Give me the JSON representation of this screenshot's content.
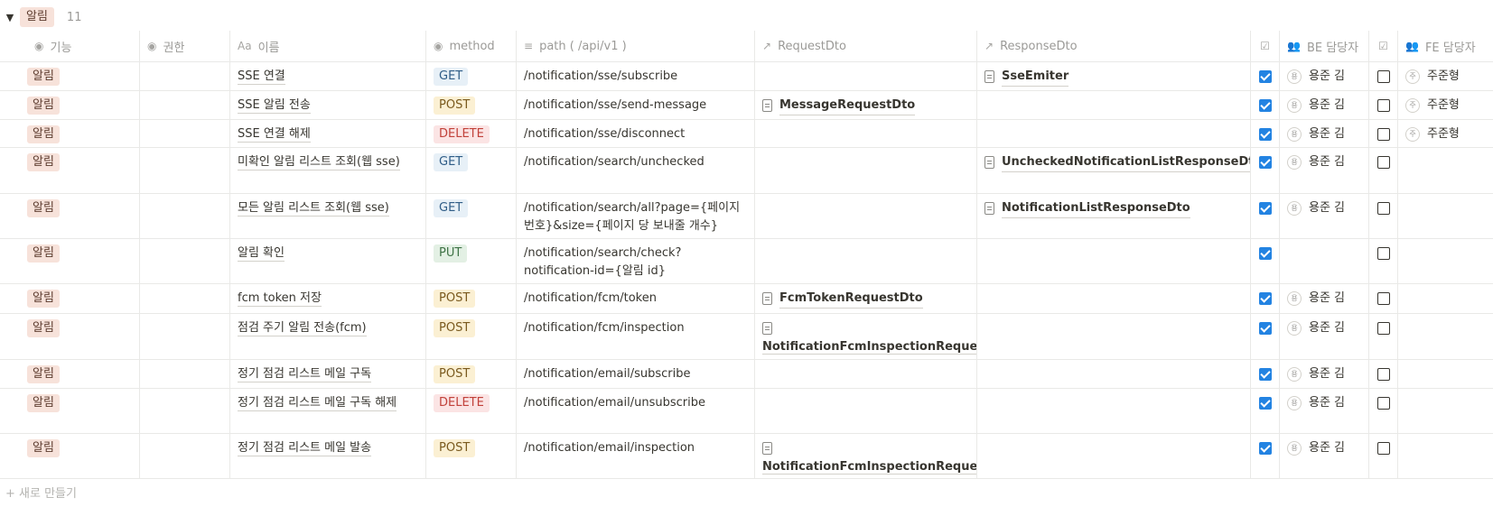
{
  "group": {
    "label": "알림",
    "count": "11",
    "toggle_icon": "▼"
  },
  "headers": {
    "feature": {
      "icon": "◉",
      "label": "기능"
    },
    "auth": {
      "icon": "◉",
      "label": "권한"
    },
    "name": {
      "icon": "Aa",
      "label": "이름"
    },
    "method": {
      "icon": "◉",
      "label": "method"
    },
    "path": {
      "icon": "≡",
      "label": "path ( /api/v1 )"
    },
    "req": {
      "icon": "↗",
      "label": "RequestDto"
    },
    "res": {
      "icon": "↗",
      "label": "ResponseDto"
    },
    "becheck": {
      "icon": "☑",
      "label": ""
    },
    "be": {
      "icon": "👥",
      "label": "BE 담당자"
    },
    "fecheck": {
      "icon": "☑",
      "label": ""
    },
    "fe": {
      "icon": "👥",
      "label": "FE 담당자"
    }
  },
  "method_colors": {
    "GET": {
      "bg": "#e7f0f7",
      "fg": "#2f5d87"
    },
    "POST": {
      "bg": "#fbf0d3",
      "fg": "#7a5a1e"
    },
    "DELETE": {
      "bg": "#fbe4e4",
      "fg": "#c1413a"
    },
    "PUT": {
      "bg": "#e3f0e4",
      "fg": "#3f7346"
    }
  },
  "rows": [
    {
      "feature": "알림",
      "name": "SSE 연결",
      "method": "GET",
      "path": "/notification/sse/subscribe",
      "req": "",
      "req_block": false,
      "res": "SseEmiter",
      "be_check": true,
      "be": "용준 김",
      "be_initial": "용",
      "fe_check": false,
      "fe": "주준형",
      "fe_initial": "주",
      "h": 32
    },
    {
      "feature": "알림",
      "name": "SSE 알림 전송",
      "method": "POST",
      "path": "/notification/sse/send-message",
      "req": "MessageRequestDto",
      "req_block": false,
      "res": "",
      "be_check": true,
      "be": "용준 김",
      "be_initial": "용",
      "fe_check": false,
      "fe": "주준형",
      "fe_initial": "주",
      "h": 32
    },
    {
      "feature": "알림",
      "name": "SSE 연결 해제",
      "method": "DELETE",
      "path": "/notification/sse/disconnect",
      "req": "",
      "req_block": false,
      "res": "",
      "be_check": true,
      "be": "용준 김",
      "be_initial": "용",
      "fe_check": false,
      "fe": "주준형",
      "fe_initial": "주",
      "h": 31
    },
    {
      "feature": "알림",
      "name": "미확인 알림 리스트 조회(웹 sse)",
      "method": "GET",
      "path": "/notification/search/unchecked",
      "req": "",
      "req_block": false,
      "res": "UncheckedNotificationListResponseDto",
      "be_check": true,
      "be": "용준 김",
      "be_initial": "용",
      "fe_check": false,
      "fe": "",
      "fe_initial": "",
      "h": 51
    },
    {
      "feature": "알림",
      "name": "모든 알림 리스트 조회(웹 sse)",
      "method": "GET",
      "path": "/notification/search/all?page={페이지번호}&size={페이지 당 보내줄 개수}",
      "req": "",
      "req_block": false,
      "res": "NotificationListResponseDto",
      "be_check": true,
      "be": "용준 김",
      "be_initial": "용",
      "fe_check": false,
      "fe": "",
      "fe_initial": "",
      "h": 50
    },
    {
      "feature": "알림",
      "name": "알림 확인",
      "method": "PUT",
      "path": "/notification/search/check?notification-id={알림 id}",
      "req": "",
      "req_block": false,
      "res": "",
      "be_check": true,
      "be": "",
      "be_initial": "",
      "fe_check": false,
      "fe": "",
      "fe_initial": "",
      "h": 50
    },
    {
      "feature": "알림",
      "name": "fcm token 저장",
      "method": "POST",
      "path": "/notification/fcm/token",
      "req": "FcmTokenRequestDto",
      "req_block": false,
      "res": "",
      "be_check": true,
      "be": "용준 김",
      "be_initial": "용",
      "fe_check": false,
      "fe": "",
      "fe_initial": "",
      "h": 33
    },
    {
      "feature": "알림",
      "name": "점검 주기 알림 전송(fcm)",
      "method": "POST",
      "path": "/notification/fcm/inspection",
      "req": "NotificationFcmInspectionRequestDto",
      "req_block": true,
      "res": "",
      "be_check": true,
      "be": "용준 김",
      "be_initial": "용",
      "fe_check": false,
      "fe": "",
      "fe_initial": "",
      "h": 51
    },
    {
      "feature": "알림",
      "name": "정기 점검 리스트 메일 구독",
      "method": "POST",
      "path": "/notification/email/subscribe",
      "req": "",
      "req_block": false,
      "res": "",
      "be_check": true,
      "be": "용준 김",
      "be_initial": "용",
      "fe_check": false,
      "fe": "",
      "fe_initial": "",
      "h": 32
    },
    {
      "feature": "알림",
      "name": "정기 점검 리스트 메일 구독 해제",
      "method": "DELETE",
      "path": "/notification/email/unsubscribe",
      "req": "",
      "req_block": false,
      "res": "",
      "be_check": true,
      "be": "용준 김",
      "be_initial": "용",
      "fe_check": false,
      "fe": "",
      "fe_initial": "",
      "h": 50
    },
    {
      "feature": "알림",
      "name": "정기 점검 리스트 메일 발송",
      "method": "POST",
      "path": "/notification/email/inspection",
      "req": "NotificationFcmInspectionRequestDto",
      "req_block": true,
      "res": "",
      "be_check": true,
      "be": "용준 김",
      "be_initial": "용",
      "fe_check": false,
      "fe": "",
      "fe_initial": "",
      "h": 50
    }
  ],
  "footer": {
    "label": "+ 새로 만들기"
  }
}
